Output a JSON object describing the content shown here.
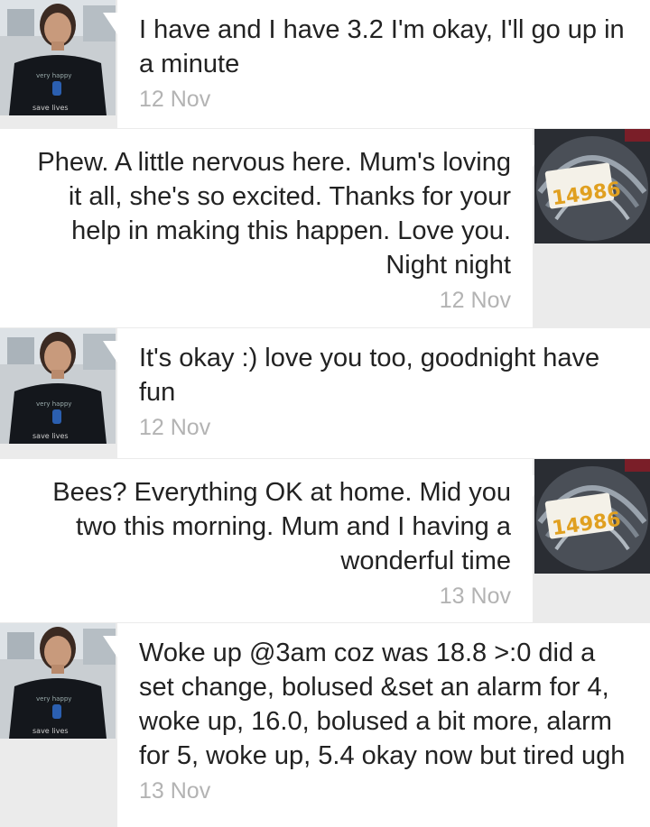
{
  "conversation": {
    "messages": [
      {
        "direction": "incoming",
        "text": "I have and I have 3.2 I'm okay, I'll go up in a minute",
        "time": "12 Nov"
      },
      {
        "direction": "outgoing",
        "text": "Phew. A little nervous here. Mum's loving it all, she's so excited. Thanks for your help in making this happen. Love you. Night night",
        "time": "12 Nov"
      },
      {
        "direction": "incoming",
        "text": "It's okay :) love you too, goodnight have fun",
        "time": "12 Nov"
      },
      {
        "direction": "outgoing",
        "text": "Bees? Everything OK at home. Mid you two this morning. Mum and I having a wonderful time",
        "time": "13 Nov"
      },
      {
        "direction": "incoming",
        "text": "Woke up @3am coz was 18.8 >:0 did a set change, bolused &set an alarm for 4, woke up, 16.0, bolused a bit more, alarm for 5, woke up, 5.4 okay now but tired ugh",
        "time": "13 Nov"
      }
    ],
    "avatars": {
      "incoming": {
        "shirt_text_top": "very happy",
        "shirt_text_bottom": "save lives"
      },
      "outgoing": {
        "bib_number": "14986"
      }
    }
  },
  "colors": {
    "bubble": "#ffffff",
    "background": "#ebebeb",
    "text": "#222222",
    "timestamp": "#b3b3b3"
  }
}
